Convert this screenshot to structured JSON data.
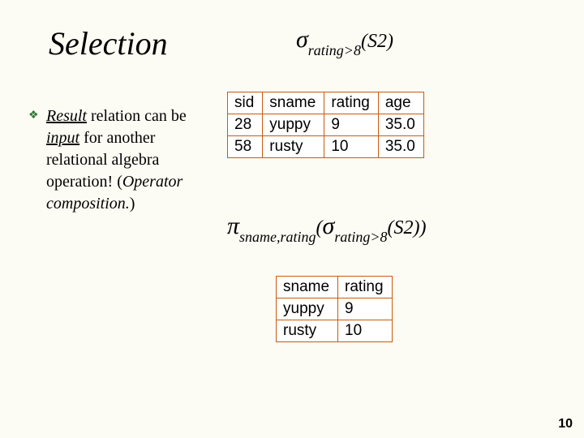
{
  "title": "Selection",
  "bullet": {
    "word_result": "Result",
    "phrase1": " relation can be ",
    "word_input": "input",
    "phrase2": " for another relational algebra operation! (",
    "word_opcomp": "Operator composition.",
    "phrase3": ")"
  },
  "formula1": {
    "sigma": "σ",
    "subscript": "rating>8",
    "arg": "(S2)"
  },
  "formula2": {
    "pi": "π",
    "pi_sub": "sname,rating",
    "open": "(",
    "sigma": "σ",
    "sigma_sub": "rating>8",
    "arg": "(S2))"
  },
  "table1": {
    "headers": [
      "sid",
      "sname",
      "rating",
      "age"
    ],
    "rows": [
      [
        "28",
        "yuppy",
        "9",
        "35.0"
      ],
      [
        "58",
        "rusty",
        "10",
        "35.0"
      ]
    ]
  },
  "table2": {
    "headers": [
      "sname",
      "rating"
    ],
    "rows": [
      [
        "yuppy",
        "9"
      ],
      [
        "rusty",
        "10"
      ]
    ]
  },
  "pagenum": "10"
}
